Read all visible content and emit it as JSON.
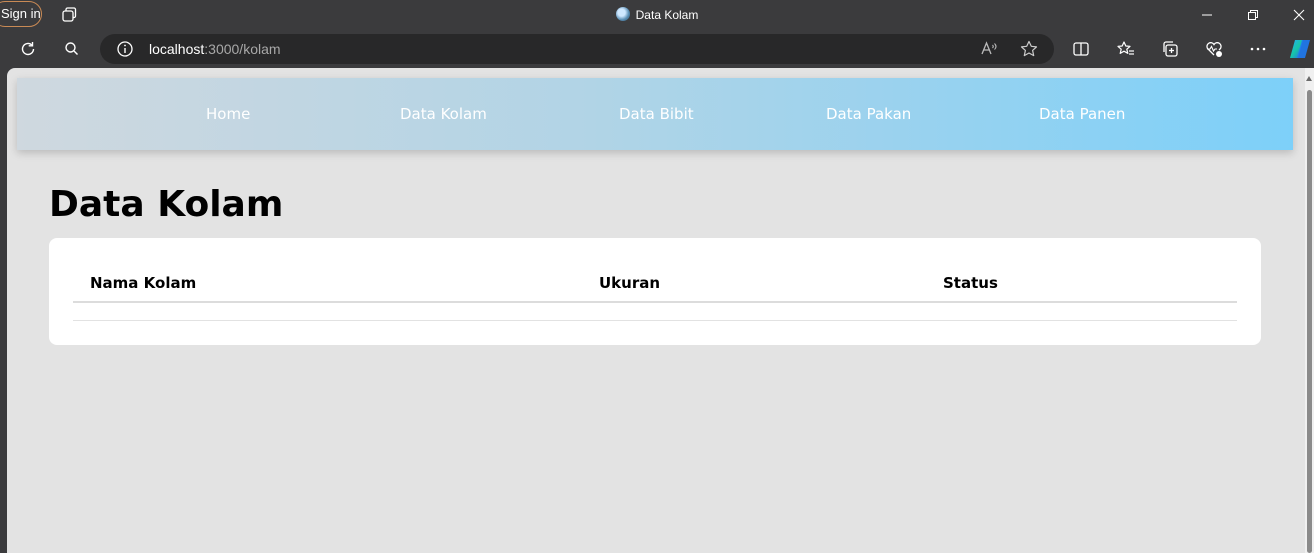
{
  "browser": {
    "signin_label": "Sign in",
    "tab_title": "Data Kolam",
    "address": {
      "host": "localhost",
      "rest": ":3000/kolam"
    }
  },
  "nav": {
    "items": [
      {
        "label": "Home"
      },
      {
        "label": "Data Kolam"
      },
      {
        "label": "Data Bibit"
      },
      {
        "label": "Data Pakan"
      },
      {
        "label": "Data Panen"
      }
    ]
  },
  "page": {
    "title": "Data Kolam",
    "table": {
      "columns": [
        "Nama Kolam",
        "Ukuran",
        "Status"
      ],
      "rows": []
    }
  },
  "icons": {
    "tabs": "tabs-icon",
    "refresh": "refresh-icon",
    "search": "search-icon",
    "info": "info-icon",
    "read_aloud": "read-aloud-icon",
    "favorite": "star-icon",
    "split": "split-screen-icon",
    "favorites": "favorites-icon",
    "collections": "collections-icon",
    "health": "browser-essentials-icon",
    "more": "more-icon",
    "copilot": "copilot-icon"
  },
  "colors": {
    "chrome": "#3b3b3d",
    "page_bg": "#e3e3e3",
    "nav_gradient_start": "#cfd8df",
    "nav_gradient_end": "#7dd0f9"
  }
}
